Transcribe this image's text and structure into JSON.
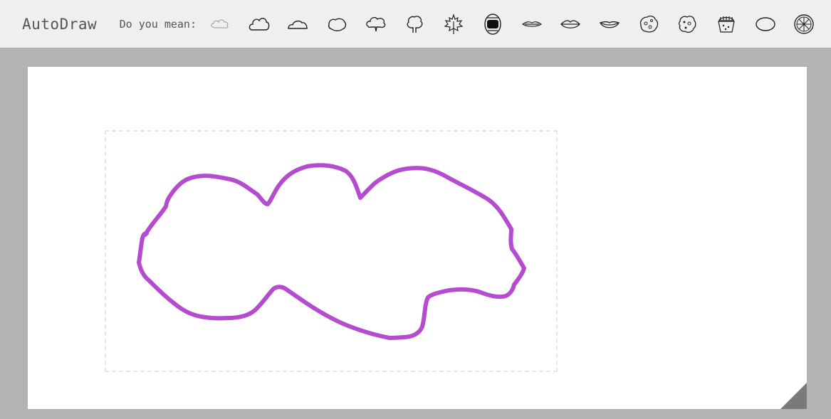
{
  "app": {
    "title": "AutoDraw"
  },
  "suggestions_bar": {
    "label": "Do you mean:",
    "items": [
      {
        "name": "cloud-small-icon"
      },
      {
        "name": "cloud-icon"
      },
      {
        "name": "cloud-flat-icon"
      },
      {
        "name": "cloud-round-icon"
      },
      {
        "name": "tree-cloud-icon"
      },
      {
        "name": "tree-icon"
      },
      {
        "name": "maple-leaf-icon"
      },
      {
        "name": "mouth-open-icon"
      },
      {
        "name": "lips-thin-icon"
      },
      {
        "name": "lips-icon"
      },
      {
        "name": "lips-smile-icon"
      },
      {
        "name": "cookie-icon"
      },
      {
        "name": "cookie-chip-icon"
      },
      {
        "name": "cupcake-icon"
      },
      {
        "name": "ellipse-icon"
      },
      {
        "name": "wheel-icon"
      }
    ]
  },
  "drawing": {
    "stroke_color": "#b54ccf"
  }
}
